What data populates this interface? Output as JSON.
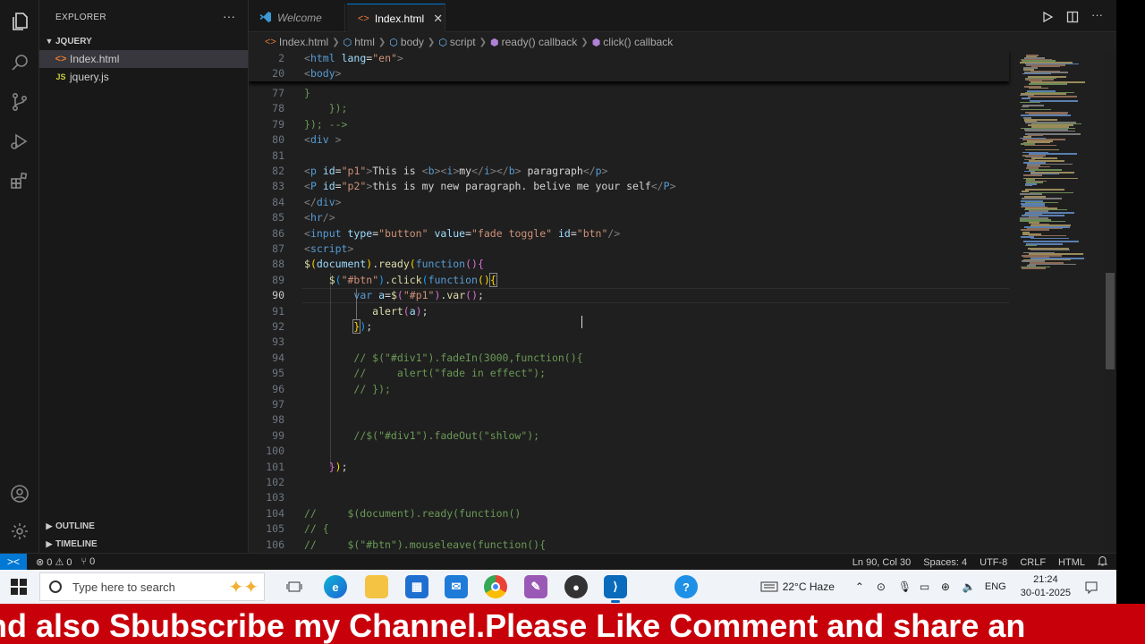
{
  "sidebar": {
    "title": "EXPLORER",
    "more": "···",
    "folder": "JQUERY",
    "files": [
      {
        "name": "Index.html",
        "icon": "<>"
      },
      {
        "name": "jquery.js",
        "icon": "JS"
      }
    ],
    "outline": "OUTLINE",
    "timeline": "TIMELINE"
  },
  "tabs": [
    {
      "label": "Welcome",
      "icon": "vscode-logo-icon"
    },
    {
      "label": "Index.html",
      "icon": "<>",
      "close": "✕"
    }
  ],
  "breadcrumb": [
    "Index.html",
    "html",
    "body",
    "script",
    "ready() callback",
    "click() callback"
  ],
  "editor": {
    "sticky": [
      {
        "n": "2",
        "html": "<span class=\"tg\">&lt;</span><span class=\"tn\">html</span> <span class=\"at\">lang</span><span class=\"pn\">=</span><span class=\"st\">\"en\"</span><span class=\"tg\">&gt;</span>"
      },
      {
        "n": "20",
        "html": "<span class=\"tg\">&lt;</span><span class=\"tn\">body</span><span class=\"tg\">&gt;</span>"
      }
    ],
    "lines": [
      {
        "n": "77",
        "html": "<span class=\"cm\">}</span>"
      },
      {
        "n": "78",
        "html": "<span class=\"cm\">    });</span>"
      },
      {
        "n": "79",
        "html": "<span class=\"cm\">}); --&gt;</span>"
      },
      {
        "n": "80",
        "html": "<span class=\"tg\">&lt;</span><span class=\"tn\">div</span> <span class=\"tg\">&gt;</span>"
      },
      {
        "n": "81",
        "html": ""
      },
      {
        "n": "82",
        "html": "<span class=\"tg\">&lt;</span><span class=\"tn\">p</span> <span class=\"at\">id</span><span class=\"pn\">=</span><span class=\"st\">\"p1\"</span><span class=\"tg\">&gt;</span><span class=\"tx\">This is </span><span class=\"tg\">&lt;</span><span class=\"tn\">b</span><span class=\"tg\">&gt;&lt;</span><span class=\"tn\">i</span><span class=\"tg\">&gt;</span><span class=\"tx\">my</span><span class=\"tg\">&lt;/</span><span class=\"tn\">i</span><span class=\"tg\">&gt;&lt;/</span><span class=\"tn\">b</span><span class=\"tg\">&gt;</span><span class=\"tx\"> paragraph</span><span class=\"tg\">&lt;/</span><span class=\"tn\">p</span><span class=\"tg\">&gt;</span>"
      },
      {
        "n": "83",
        "html": "<span class=\"tg\">&lt;</span><span class=\"tn\">P</span> <span class=\"at\">id</span><span class=\"pn\">=</span><span class=\"st\">\"p2\"</span><span class=\"tg\">&gt;</span><span class=\"tx\">this is my new paragraph. belive me your self</span><span class=\"tg\">&lt;/</span><span class=\"tn\">P</span><span class=\"tg\">&gt;</span>"
      },
      {
        "n": "84",
        "html": "<span class=\"tg\">&lt;/</span><span class=\"tn\">div</span><span class=\"tg\">&gt;</span>"
      },
      {
        "n": "85",
        "html": "<span class=\"tg\">&lt;</span><span class=\"tn\">hr</span><span class=\"tg\">/&gt;</span>"
      },
      {
        "n": "86",
        "html": "<span class=\"tg\">&lt;</span><span class=\"tn\">input</span> <span class=\"at\">type</span><span class=\"pn\">=</span><span class=\"st\">\"button\"</span> <span class=\"at\">value</span><span class=\"pn\">=</span><span class=\"st\">\"fade toggle\"</span> <span class=\"at\">id</span><span class=\"pn\">=</span><span class=\"st\">\"btn\"</span><span class=\"tg\">/&gt;</span>"
      },
      {
        "n": "87",
        "html": "<span class=\"tg\">&lt;</span><span class=\"tn\">script</span><span class=\"tg\">&gt;</span>"
      },
      {
        "n": "88",
        "html": "<span class=\"fn\">$</span><span class=\"br1\">(</span><span class=\"vr\">document</span><span class=\"br1\">)</span><span class=\"pn\">.</span><span class=\"fn\">ready</span><span class=\"br1\">(</span><span class=\"kw\">function</span><span class=\"br2\">()</span><span class=\"br2\">{</span>"
      },
      {
        "n": "89",
        "html": "    <span class=\"fn\">$</span><span class=\"br3\">(</span><span class=\"st\">\"#btn\"</span><span class=\"br3\">)</span><span class=\"pn\">.</span><span class=\"fn\">click</span><span class=\"br3\">(</span><span class=\"kw\">function</span><span class=\"br1\">()</span><span class=\"br1\" style=\"outline:1px solid #888\">{</span>"
      },
      {
        "n": "90",
        "cur": true,
        "html": "        <span class=\"kw\">var</span> <span class=\"vr\">a</span><span class=\"pn\">=</span><span class=\"fn\">$</span><span class=\"br2\">(</span><span class=\"st\">\"#p1\"</span><span class=\"br2\">)</span><span class=\"pn\">.</span><span class=\"fn\">var</span><span class=\"br2\">()</span><span class=\"pn\">;</span>"
      },
      {
        "n": "91",
        "html": "           <span class=\"fn\">alert</span><span class=\"br2\">(</span><span class=\"vr\">a</span><span class=\"br2\">)</span><span class=\"pn\">;</span>"
      },
      {
        "n": "92",
        "html": "        <span class=\"br1\" style=\"outline:1px solid #888\">}</span><span class=\"br3\">)</span><span class=\"pn\">;</span>"
      },
      {
        "n": "93",
        "html": ""
      },
      {
        "n": "94",
        "html": "        <span class=\"cm\">// $(\"#div1\").fadeIn(3000,function(){</span>"
      },
      {
        "n": "95",
        "html": "        <span class=\"cm\">//     alert(\"fade in effect\");</span>"
      },
      {
        "n": "96",
        "html": "        <span class=\"cm\">// });</span>"
      },
      {
        "n": "97",
        "html": ""
      },
      {
        "n": "98",
        "html": ""
      },
      {
        "n": "99",
        "html": "        <span class=\"cm\">//$(\"#div1\").fadeOut(\"shlow\");</span>"
      },
      {
        "n": "100",
        "html": ""
      },
      {
        "n": "101",
        "html": "    <span class=\"br2\">}</span><span class=\"br1\">)</span><span class=\"pn\">;</span>"
      },
      {
        "n": "102",
        "html": ""
      },
      {
        "n": "103",
        "html": ""
      },
      {
        "n": "104",
        "html": "<span class=\"cm\">//     $(document).ready(function()</span>"
      },
      {
        "n": "105",
        "html": "<span class=\"cm\">// {</span>"
      },
      {
        "n": "106",
        "html": "<span class=\"cm\">//     $(\"#btn\").mouseleave(function(){</span>"
      }
    ]
  },
  "status": {
    "remote": "><",
    "problems": "⊗ 0 ⚠ 0",
    "ports": "⑂ 0",
    "position": "Ln 90, Col 30",
    "spaces": "Spaces: 4",
    "encoding": "UTF-8",
    "eol": "CRLF",
    "language": "HTML",
    "bell": "🔔"
  },
  "taskbar": {
    "search_placeholder": "Type here to search",
    "weather": "22°C  Haze",
    "lang": "ENG",
    "time": "21:24",
    "date": "30-01-2025"
  },
  "banner": {
    "text": "nd also Sbubscribe my Channel.Please Like Comment and share an"
  },
  "colors": {
    "editor_bg": "#1f1f1f",
    "accent": "#0078d4",
    "banner_bg": "#c8000a"
  }
}
